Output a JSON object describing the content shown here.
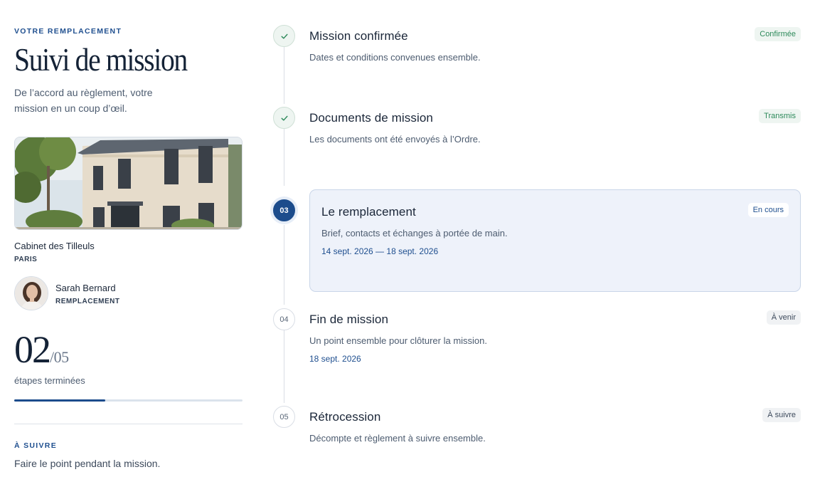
{
  "left": {
    "eyebrow": "VOTRE REMPLACEMENT",
    "title": "Suivi de mission",
    "subtitle": "De l’accord au règlement, votre mission en un coup d’œil.",
    "cabinet": {
      "name": "Cabinet des Tilleuls",
      "city": "PARIS"
    },
    "person": {
      "name": "Sarah Bernard",
      "role": "REMPLACEMENT"
    },
    "progress": {
      "done": "02",
      "total": "/05",
      "label": "étapes terminées",
      "fraction": 0.4
    },
    "next": {
      "label": "À SUIVRE",
      "text": "Faire le point pendant la mission."
    }
  },
  "steps": [
    {
      "marker": "",
      "state": "done",
      "title": "Mission confirmée",
      "desc": "Dates et conditions convenues ensemble.",
      "date": "",
      "badge": "Confirmée",
      "icon": "check-icon"
    },
    {
      "marker": "",
      "state": "done",
      "title": "Documents de mission",
      "desc": "Les documents ont été envoyés à l’Ordre.",
      "date": "",
      "badge": "Transmis",
      "icon": "check-icon"
    },
    {
      "marker": "03",
      "state": "current",
      "title": "Le remplacement",
      "desc": "Brief, contacts et échanges à portée de main.",
      "date": "14 sept. 2026 — 18 sept. 2026",
      "badge": "En cours"
    },
    {
      "marker": "04",
      "state": "upcoming",
      "title": "Fin de mission",
      "desc": "Un point ensemble pour clôturer la mission.",
      "date": "18 sept. 2026",
      "badge": "À venir"
    },
    {
      "marker": "05",
      "state": "upcoming",
      "title": "Rétrocession",
      "desc": "Décompte et règlement à suivre ensemble.",
      "date": "",
      "badge": "À suivre"
    }
  ],
  "colors": {
    "accent": "#1c4c8c",
    "success": "#2e8a5b",
    "current_bg": "#eef2fa"
  }
}
